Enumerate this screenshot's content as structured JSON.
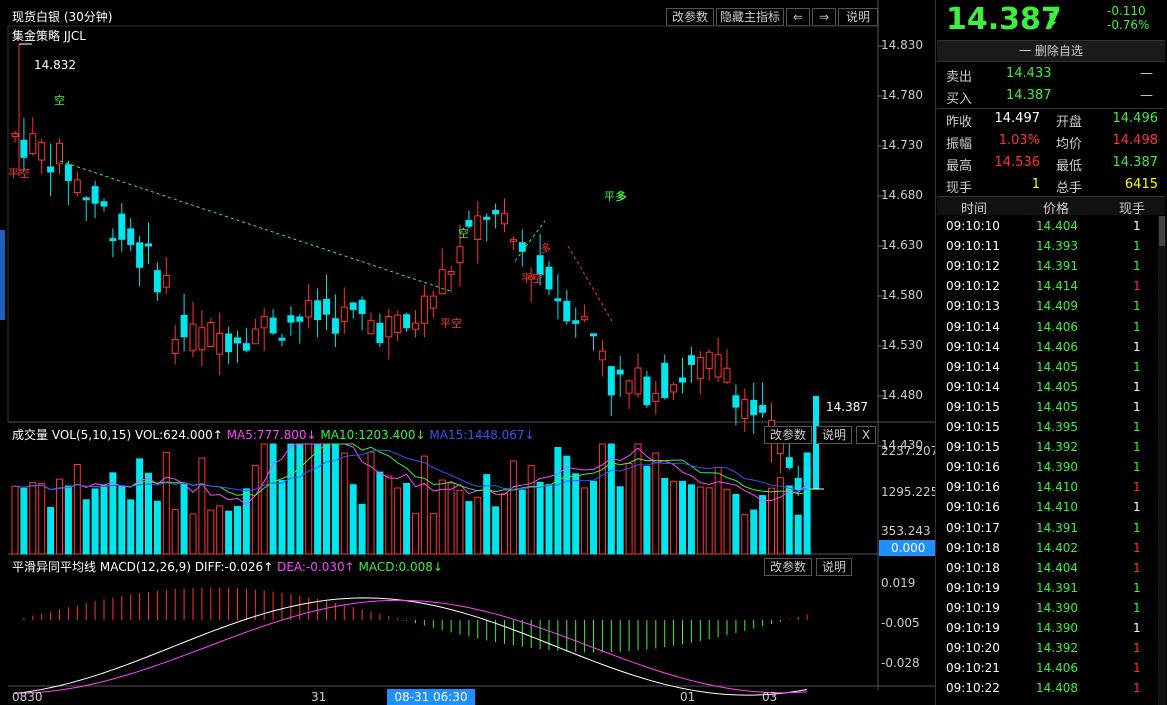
{
  "chart": {
    "title": "现货白银 (30分钟)",
    "strategy": "集金策略 JJCL",
    "buttons": [
      "改参数",
      "隐藏主指标",
      "⇐",
      "⇒",
      "说明"
    ],
    "high_label": "14.832",
    "last_label": "14.387",
    "price_ticks": [
      "14.830",
      "14.780",
      "14.730",
      "14.680",
      "14.630",
      "14.580",
      "14.530",
      "14.480",
      "14.430"
    ],
    "signals": [
      "平空",
      "空",
      "空",
      "平空",
      "多",
      "平空",
      "平多",
      "多"
    ],
    "x_ticks": [
      "0830",
      "31",
      "01",
      "03"
    ],
    "cursor_time": "08-31 06:30"
  },
  "volume": {
    "label": "成交量",
    "params": "VOL(5,10,15)",
    "vol": "VOL:624.000↑",
    "ma5": "MA5:777.800↓",
    "ma10": "MA10:1203.400↓",
    "ma15": "MA15:1448.067↓",
    "buttons": [
      "改参数",
      "说明",
      "X"
    ],
    "ticks": [
      "2237.207",
      "1295.225",
      "353.243"
    ],
    "cursor_value": "0.000"
  },
  "macd": {
    "label": "平滑异同平均线",
    "params": "MACD(12,26,9)",
    "diff": "DIFF:-0.026↑",
    "dea": "DEA:-0.030↑",
    "macd": "MACD:0.008↓",
    "buttons": [
      "改参数",
      "说明"
    ],
    "ticks": [
      "0.019",
      "-0.005",
      "-0.028"
    ]
  },
  "quote": {
    "price": "14.387",
    "change": "-0.110",
    "change_pct": "-0.76%",
    "watchlist_button": "一 删除自选",
    "sell_label": "卖出",
    "sell_value": "14.433",
    "sell_qty": "—",
    "buy_label": "买入",
    "buy_value": "14.387",
    "buy_qty": "—",
    "stats": [
      {
        "l1": "昨收",
        "v1": "14.497",
        "c1": "#ffffff",
        "l2": "开盘",
        "v2": "14.496",
        "c2": "#3df03d"
      },
      {
        "l1": "振幅",
        "v1": "1.03%",
        "c1": "#ff3232",
        "l2": "均价",
        "v2": "14.498",
        "c2": "#ff3232"
      },
      {
        "l1": "最高",
        "v1": "14.536",
        "c1": "#ff3232",
        "l2": "最低",
        "v2": "14.387",
        "c2": "#3df03d"
      },
      {
        "l1": "现手",
        "v1": "1",
        "c1": "#ffff00",
        "l2": "总手",
        "v2": "6415",
        "c2": "#ffff00"
      }
    ]
  },
  "ticks_table": {
    "headers": [
      "时间",
      "价格",
      "现手"
    ],
    "rows": [
      [
        "09:10:10",
        "14.404",
        "1",
        "w"
      ],
      [
        "09:10:11",
        "14.393",
        "1",
        "g"
      ],
      [
        "09:10:12",
        "14.391",
        "1",
        "g"
      ],
      [
        "09:10:12",
        "14.414",
        "1",
        "r"
      ],
      [
        "09:10:13",
        "14.409",
        "1",
        "g"
      ],
      [
        "09:10:14",
        "14.406",
        "1",
        "g"
      ],
      [
        "09:10:14",
        "14.406",
        "1",
        "w"
      ],
      [
        "09:10:14",
        "14.405",
        "1",
        "g"
      ],
      [
        "09:10:14",
        "14.405",
        "1",
        "w"
      ],
      [
        "09:10:15",
        "14.405",
        "1",
        "w"
      ],
      [
        "09:10:15",
        "14.395",
        "1",
        "g"
      ],
      [
        "09:10:15",
        "14.392",
        "1",
        "g"
      ],
      [
        "09:10:16",
        "14.390",
        "1",
        "g"
      ],
      [
        "09:10:16",
        "14.410",
        "1",
        "r"
      ],
      [
        "09:10:16",
        "14.410",
        "1",
        "w"
      ],
      [
        "09:10:17",
        "14.391",
        "1",
        "g"
      ],
      [
        "09:10:18",
        "14.402",
        "1",
        "r"
      ],
      [
        "09:10:18",
        "14.404",
        "1",
        "r"
      ],
      [
        "09:10:19",
        "14.391",
        "1",
        "g"
      ],
      [
        "09:10:19",
        "14.390",
        "1",
        "g"
      ],
      [
        "09:10:19",
        "14.390",
        "1",
        "w"
      ],
      [
        "09:10:20",
        "14.392",
        "1",
        "r"
      ],
      [
        "09:10:21",
        "14.406",
        "1",
        "r"
      ],
      [
        "09:10:22",
        "14.408",
        "1",
        "r"
      ]
    ]
  },
  "colors": {
    "up": "#ff3232",
    "down": "#00e5ee",
    "green": "#3df03d",
    "yellow": "#ffff00",
    "magenta": "#ff44ff",
    "blue": "#3355ff"
  }
}
